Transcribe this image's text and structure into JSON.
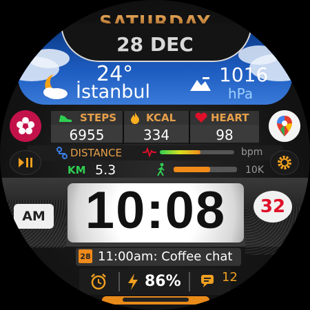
{
  "header": {
    "day": "SATURDAY",
    "date": "28 DEC"
  },
  "weather": {
    "temperature": "24°",
    "city": "İstanbul",
    "pressure_value": "1016",
    "pressure_unit": "hPa"
  },
  "stats": [
    {
      "label": "STEPS",
      "value": "6955",
      "icon": "shoe-icon"
    },
    {
      "label": "KCAL",
      "value": "334",
      "icon": "flame-icon"
    },
    {
      "label": "HEART",
      "value": "98",
      "icon": "heart-icon"
    }
  ],
  "distance": {
    "label": "DISTANCE",
    "unit": "KM",
    "value": "5.3",
    "goal_label": "10K",
    "progress": 0.58
  },
  "heart_bar": {
    "unit": "bpm",
    "level": 0.55
  },
  "time": {
    "hh": "10",
    "mm": "08",
    "separator": ":",
    "ampm": "AM",
    "seconds": "32"
  },
  "event": {
    "day_badge": "28",
    "text": "11:00am: Coffee chat"
  },
  "bottom": {
    "battery": "86%",
    "messages": "12"
  },
  "colors": {
    "accent": "#e8a04a",
    "seconds": "#e0102a",
    "sky": "#1d5cc0"
  }
}
